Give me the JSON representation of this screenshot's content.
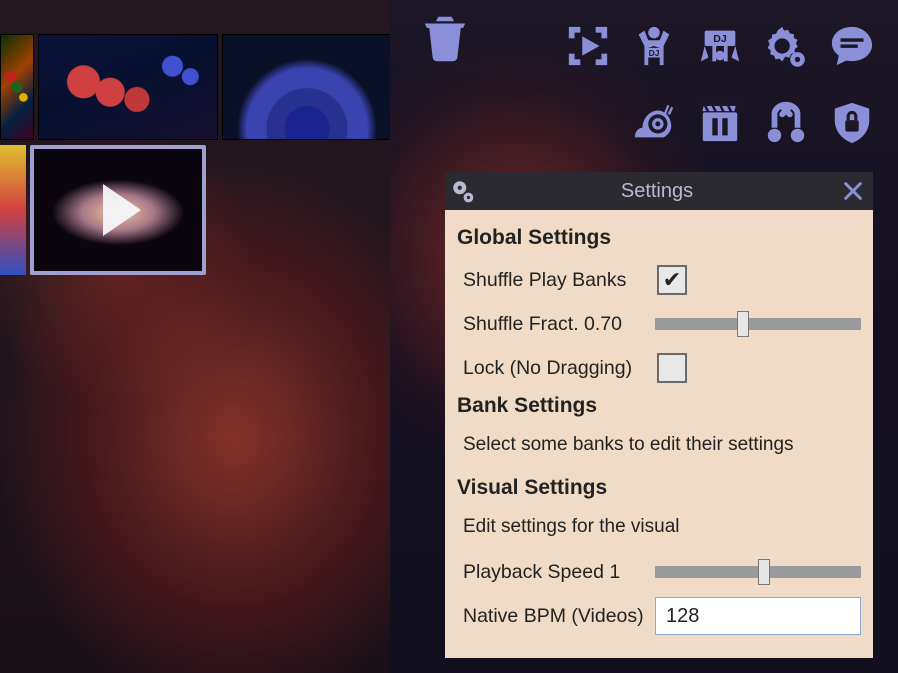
{
  "toolbar": {
    "icons": {
      "trash": "trash-icon",
      "fullscreen_play": "fullscreen-play-icon",
      "dj_person": "dj-person-icon",
      "dj_banner": "dj-banner-icon",
      "gears": "settings-gears-icon",
      "chat": "chat-bubble-icon",
      "snail": "snail-icon",
      "clapper_pause": "pause-clapper-icon",
      "shuffle_swap": "shuffle-swap-icon",
      "lock_shield": "lock-shield-icon"
    }
  },
  "settings": {
    "title": "Settings",
    "global": {
      "heading": "Global Settings",
      "shuffle_play_label": "Shuffle Play Banks",
      "shuffle_play_checked": true,
      "shuffle_fract_label": "Shuffle Fract.",
      "shuffle_fract_value": "0.70",
      "shuffle_fract_slider_pos": 0.4,
      "lock_label": "Lock (No Dragging)",
      "lock_checked": false
    },
    "bank": {
      "heading": "Bank Settings",
      "hint": "Select some banks to edit their settings"
    },
    "visual": {
      "heading": "Visual Settings",
      "hint": "Edit settings for the visual",
      "playback_speed_label": "Playback Speed",
      "playback_speed_value": "1",
      "playback_speed_slider_pos": 0.5,
      "native_bpm_label": "Native BPM (Videos)",
      "native_bpm_value": "128"
    }
  },
  "thumbnails": {
    "row1": [
      "fractal-a",
      "fractal-b",
      "fractal-c",
      "fractal-c"
    ],
    "play_tile_visible": true
  }
}
